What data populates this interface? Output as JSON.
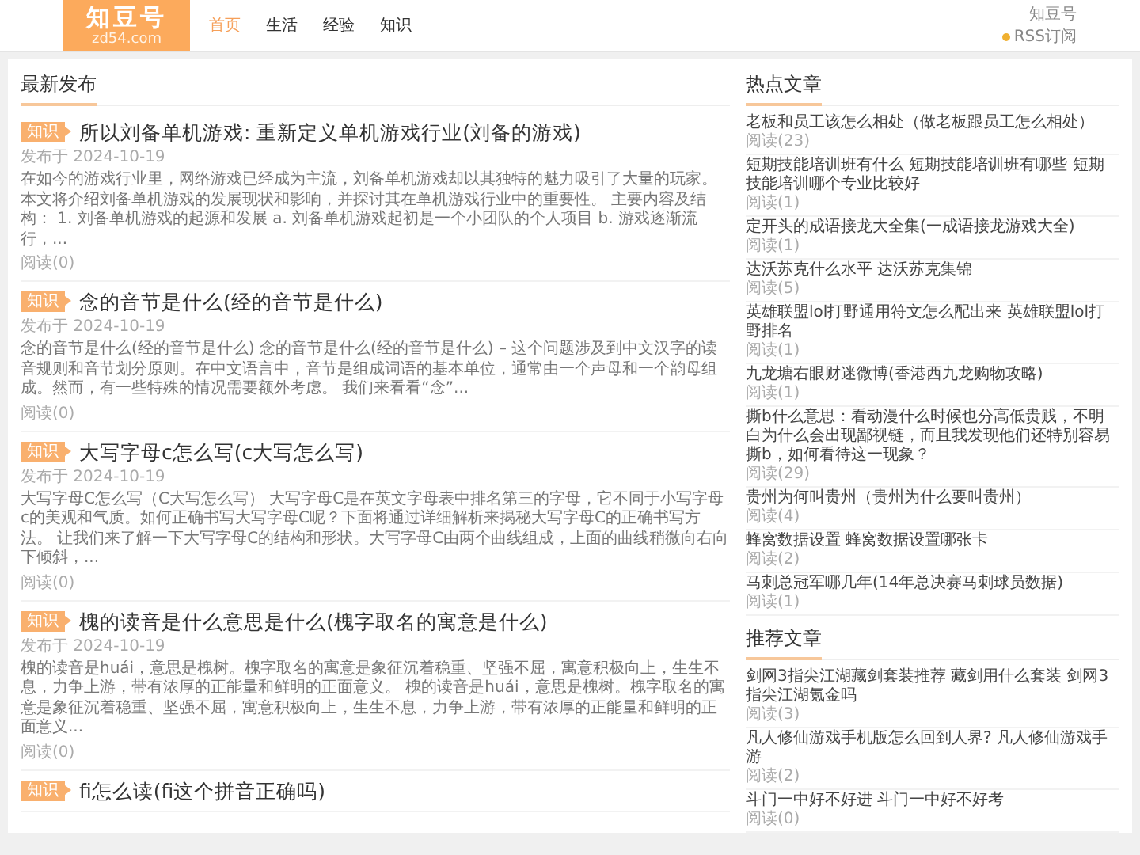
{
  "header": {
    "logo_title": "知豆号",
    "logo_domain": "zd54.com",
    "nav": [
      {
        "label": "首页",
        "selected": true
      },
      {
        "label": "生活",
        "selected": false
      },
      {
        "label": "经验",
        "selected": false
      },
      {
        "label": "知识",
        "selected": false
      }
    ],
    "site_name": "知豆号",
    "rss": "RSS订阅"
  },
  "latest": {
    "heading": "最新发布",
    "articles": [
      {
        "tag": "知识",
        "title": "所以刘备单机游戏: 重新定义单机游戏行业(刘备的游戏)",
        "date": "发布于 2024-10-19",
        "summary": "在如今的游戏行业里，网络游戏已经成为主流，刘备单机游戏却以其独特的魅力吸引了大量的玩家。本文将介绍刘备单机游戏的发展现状和影响，并探讨其在单机游戏行业中的重要性。 主要内容及结构： 1. 刘备单机游戏的起源和发展 a. 刘备单机游戏起初是一个小团队的个人项目 b. 游戏逐渐流行，...",
        "reads": "阅读(0)"
      },
      {
        "tag": "知识",
        "title": "念的音节是什么(经的音节是什么)",
        "date": "发布于 2024-10-19",
        "summary": "念的音节是什么(经的音节是什么) 念的音节是什么(经的音节是什么) – 这个问题涉及到中文汉字的读音规则和音节划分原则。在中文语言中，音节是组成词语的基本单位，通常由一个声母和一个韵母组成。然而，有一些特殊的情况需要额外考虑。 我们来看看“念”...",
        "reads": "阅读(0)"
      },
      {
        "tag": "知识",
        "title": "大写字母c怎么写(c大写怎么写)",
        "date": "发布于 2024-10-19",
        "summary": "大写字母C怎么写（C大写怎么写） 大写字母C是在英文字母表中排名第三的字母，它不同于小写字母c的美观和气质。如何正确书写大写字母C呢？下面将通过详细解析来揭秘大写字母C的正确书写方法。 让我们来了解一下大写字母C的结构和形状。大写字母C由两个曲线组成，上面的曲线稍微向右向下倾斜，...",
        "reads": "阅读(0)"
      },
      {
        "tag": "知识",
        "title": "槐的读音是什么意思是什么(槐字取名的寓意是什么)",
        "date": "发布于 2024-10-19",
        "summary": "槐的读音是huái，意思是槐树。槐字取名的寓意是象征沉着稳重、坚强不屈，寓意积极向上，生生不息，力争上游，带有浓厚的正能量和鲜明的正面意义。 槐的读音是huái，意思是槐树。槐字取名的寓意是象征沉着稳重、坚强不屈，寓意积极向上，生生不息，力争上游，带有浓厚的正能量和鲜明的正面意义...",
        "reads": "阅读(0)"
      },
      {
        "tag": "知识",
        "title": "fi怎么读(fi这个拼音正确吗)"
      }
    ]
  },
  "hot": {
    "heading": "热点文章",
    "items": [
      {
        "title": "老板和员工该怎么相处（做老板跟员工怎么相处）",
        "reads": "阅读(23)"
      },
      {
        "title": "短期技能培训班有什么 短期技能培训班有哪些 短期技能培训哪个专业比较好",
        "reads": "阅读(1)"
      },
      {
        "title": "定开头的成语接龙大全集(一成语接龙游戏大全)",
        "reads": "阅读(1)"
      },
      {
        "title": "达沃苏克什么水平 达沃苏克集锦",
        "reads": "阅读(5)"
      },
      {
        "title": "英雄联盟lol打野通用符文怎么配出来 英雄联盟lol打野排名",
        "reads": "阅读(1)"
      },
      {
        "title": "九龙塘右眼财迷微博(香港西九龙购物攻略)",
        "reads": "阅读(1)"
      },
      {
        "title": "撕b什么意思：看动漫什么时候也分高低贵贱，不明白为什么会出现鄙视链，而且我发现他们还特别容易撕b，如何看待这一现象？",
        "reads": "阅读(29)"
      },
      {
        "title": "贵州为何叫贵州（贵州为什么要叫贵州）",
        "reads": "阅读(4)"
      },
      {
        "title": "蜂窝数据设置 蜂窝数据设置哪张卡",
        "reads": "阅读(2)"
      },
      {
        "title": "马刺总冠军哪几年(14年总决赛马刺球员数据)",
        "reads": "阅读(1)"
      }
    ]
  },
  "recommended": {
    "heading": "推荐文章",
    "items": [
      {
        "title": "剑网3指尖江湖藏剑套装推荐 藏剑用什么套装 剑网3指尖江湖氪金吗",
        "reads": "阅读(3)"
      },
      {
        "title": "凡人修仙游戏手机版怎么回到人界? 凡人修仙游戏手游",
        "reads": "阅读(2)"
      },
      {
        "title": "斗门一中好不好进 斗门一中好不好考",
        "reads": "阅读(0)"
      }
    ]
  }
}
